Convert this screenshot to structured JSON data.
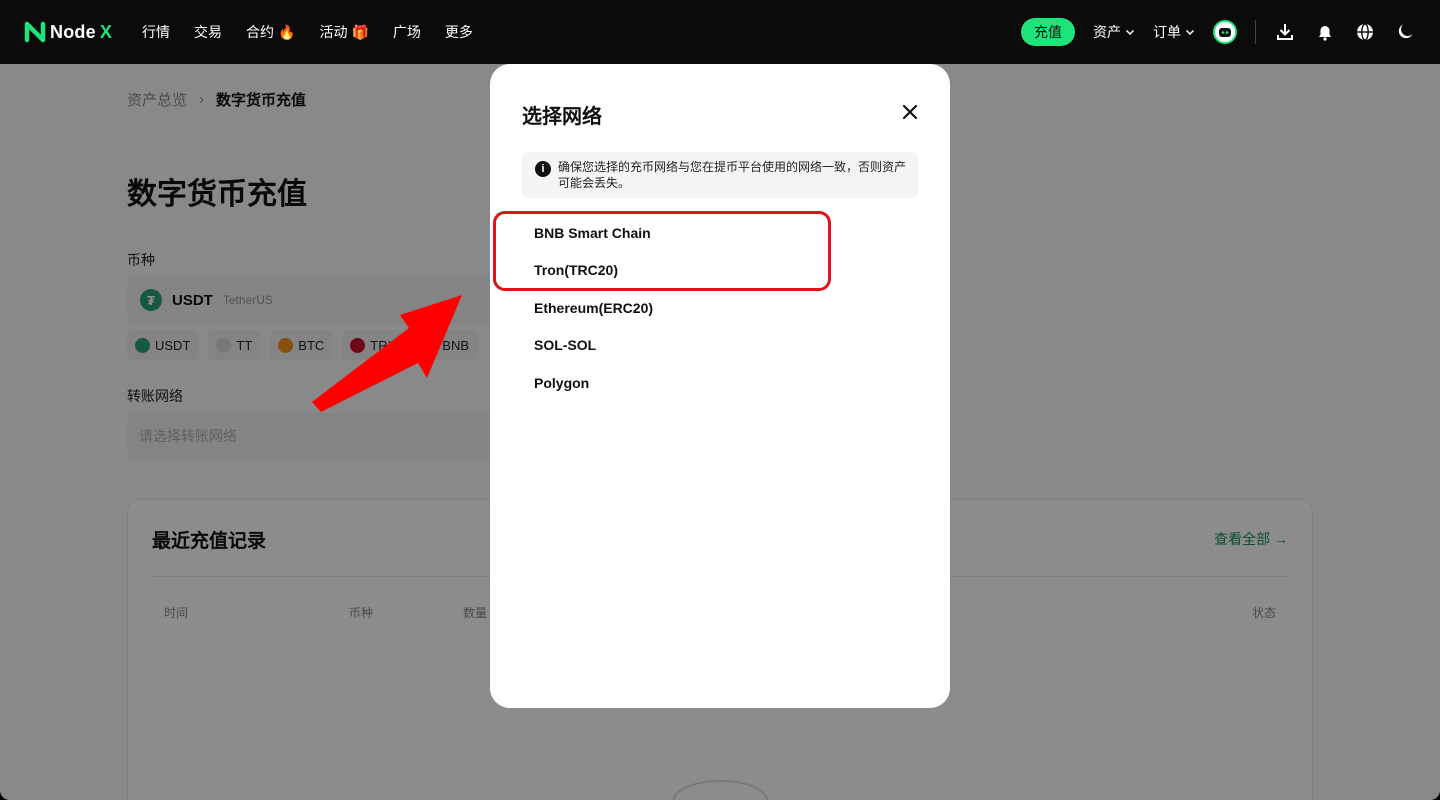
{
  "nav": {
    "logo_text": "Node",
    "logo_x": "X",
    "items": [
      {
        "label": "行情",
        "badge": ""
      },
      {
        "label": "交易",
        "badge": ""
      },
      {
        "label": "合约",
        "badge": "🔥"
      },
      {
        "label": "活动",
        "badge": "🎁"
      },
      {
        "label": "广场",
        "badge": ""
      },
      {
        "label": "更多",
        "badge": ""
      }
    ],
    "deposit_label": "充值",
    "assets_label": "资产",
    "orders_label": "订单"
  },
  "page": {
    "breadcrumb": [
      "资产总览",
      "数字货币充值"
    ],
    "title": "数字货币充值",
    "coin_label": "币种",
    "selected_coin": {
      "symbol": "USDT",
      "name": "TetherUS"
    },
    "coin_chips": [
      {
        "label": "USDT",
        "color": "#26a17b"
      },
      {
        "label": "TT",
        "color": "#d9d9d9"
      },
      {
        "label": "BTC",
        "color": "#f7931a"
      },
      {
        "label": "TRX",
        "color": "#c8102e"
      },
      {
        "label": "BNB",
        "color": "#f3ba2f"
      }
    ],
    "network_label": "转账网络",
    "network_placeholder": "请选择转账网络",
    "records": {
      "title": "最近充值记录",
      "view_all": "查看全部 →",
      "columns": [
        "时间",
        "币种",
        "数量",
        "状态"
      ]
    }
  },
  "modal": {
    "title": "选择网络",
    "notice": "确保您选择的充币网络与您在提币平台使用的网络一致，否则资产可能会丢失。",
    "networks": [
      "BNB Smart Chain",
      "Tron(TRC20)",
      "Ethereum(ERC20)",
      "SOL-SOL",
      "Polygon"
    ]
  },
  "colors": {
    "accent": "#1ee37b",
    "highlight": "#e0121a",
    "arrow": "#ff0000"
  }
}
